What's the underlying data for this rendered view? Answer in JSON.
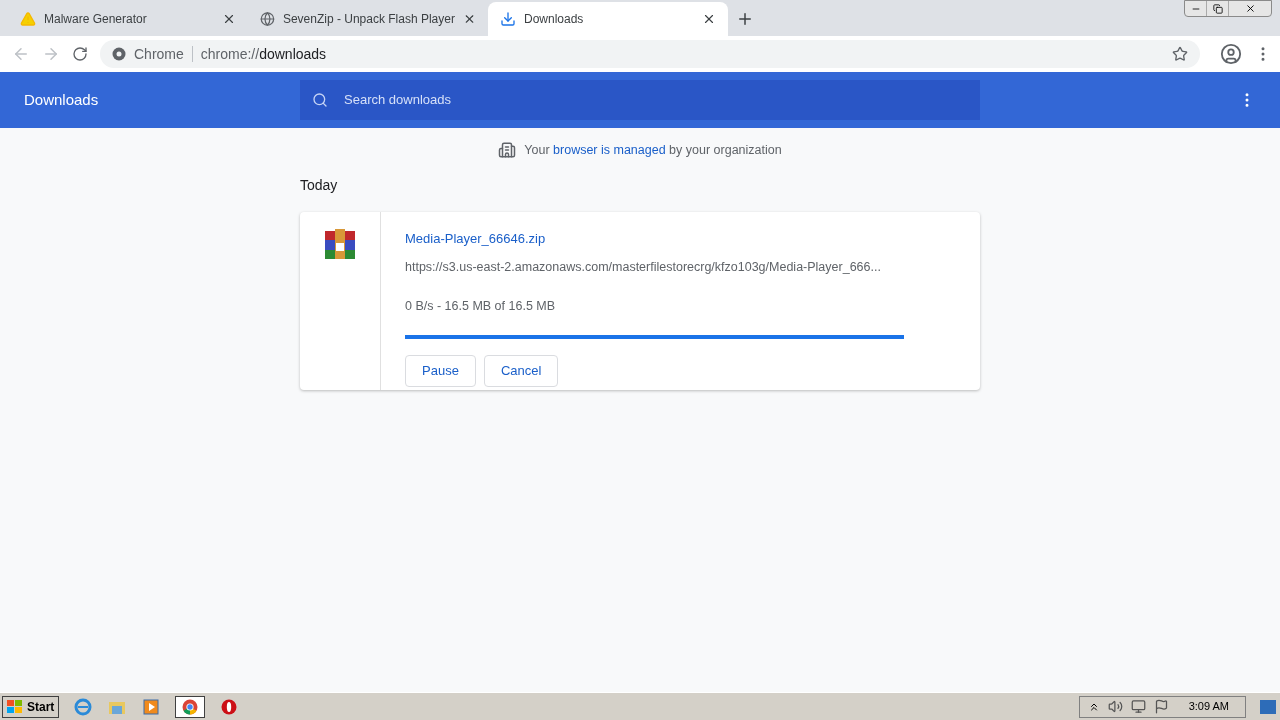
{
  "tabs": [
    {
      "title": "Malware Generator",
      "kind": "warning",
      "selected": false
    },
    {
      "title": "SevenZip - Unpack Flash Player",
      "kind": "globe",
      "selected": false
    },
    {
      "title": "Downloads",
      "kind": "download",
      "selected": true
    }
  ],
  "address": {
    "scheme_label": "Chrome",
    "url_prefix": "chrome://",
    "url_host": "downloads"
  },
  "header": {
    "title": "Downloads",
    "search_placeholder": "Search downloads"
  },
  "managed_notice": {
    "before": "Your ",
    "link": "browser is managed",
    "after": " by your organization"
  },
  "section": "Today",
  "download": {
    "file_name": "Media-Player_66646.zip",
    "url": "https://s3.us-east-2.amazonaws.com/masterfilestorecrg/kfzo103g/Media-Player_666...",
    "status": "0 B/s - 16.5 MB of 16.5 MB",
    "level": 1,
    "buttons": [
      "Pause",
      "Cancel"
    ]
  },
  "taskbar": {
    "start": "Start",
    "apps": [
      {
        "kind": "ie",
        "selected": false
      },
      {
        "kind": "explorer",
        "selected": false
      },
      {
        "kind": "media",
        "selected": false
      },
      {
        "kind": "chrome",
        "selected": true
      },
      {
        "kind": "opera",
        "selected": false
      }
    ],
    "clock": "3:09 AM"
  }
}
